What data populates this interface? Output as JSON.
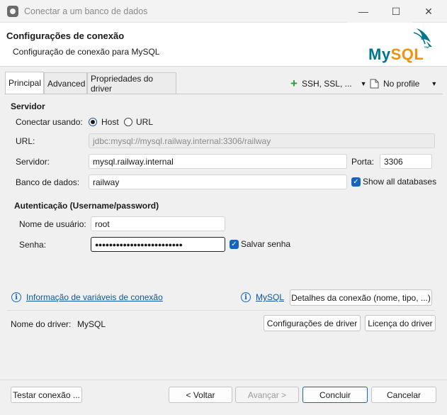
{
  "window": {
    "title": "Conectar a um banco de dados",
    "minimize": "—",
    "maximize": "☐",
    "close": "✕"
  },
  "header": {
    "title": "Configurações de conexão",
    "subtitle": "Configuração de conexão para MySQL",
    "logo_text_my": "My",
    "logo_text_sql": "SQL",
    "logo_tm": "™",
    "colors": {
      "logo_blue": "#00758f",
      "logo_orange": "#f29111"
    }
  },
  "tabs": [
    {
      "label": "Principal"
    },
    {
      "label": "Advanced"
    },
    {
      "label": "Propriedades do driver"
    }
  ],
  "toolbar": {
    "ssh_label": "SSH, SSL, ...",
    "profile_label": "No profile"
  },
  "server": {
    "section": "Servidor",
    "connect_using_label": "Conectar usando:",
    "host_option": "Host",
    "url_option": "URL",
    "url_label": "URL:",
    "url_value": "jdbc:mysql://mysql.railway.internal:3306/railway",
    "server_label": "Servidor:",
    "server_value": "mysql.railway.internal",
    "port_label": "Porta:",
    "port_value": "3306",
    "database_label": "Banco de dados:",
    "database_value": "railway",
    "show_all_label": "Show all databases"
  },
  "auth": {
    "section": "Autenticação (Username/password)",
    "username_label": "Nome de usuário:",
    "username_value": "root",
    "password_label": "Senha:",
    "password_value": "●●●●●●●●●●●●●●●●●●●●●●●●●",
    "save_password_label": "Salvar senha"
  },
  "info": {
    "variables_link": "Informação de variáveis de conexão",
    "mysql_link": "MySQL",
    "details_button": "Detalhes da conexão (nome, tipo, ...)"
  },
  "driver": {
    "name_label": "Nome do driver:",
    "name_value": "MySQL",
    "settings_button": "Configurações de driver",
    "license_button": "Licença do driver"
  },
  "footer": {
    "test_button": "Testar conexão ...",
    "back_button": "< Voltar",
    "next_button": "Avançar >",
    "finish_button": "Concluir",
    "cancel_button": "Cancelar"
  }
}
